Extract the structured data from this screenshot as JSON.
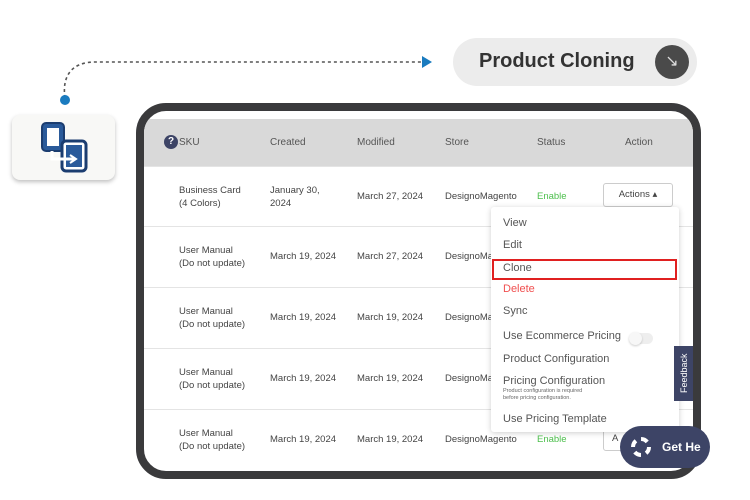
{
  "banner": {
    "title": "Product Cloning",
    "button_icon": "arrow-down-right-icon",
    "arrow_color": "#1a7bbf"
  },
  "table": {
    "headers": [
      "SKU",
      "Created",
      "Modified",
      "Store",
      "Status",
      "Action"
    ],
    "rows": [
      {
        "sku": [
          "Business Card",
          "(4 Colors)"
        ],
        "created": [
          "January 30,",
          "2024"
        ],
        "modified": "March 27, 2024",
        "store": "DesignoMagento",
        "status": "Enable",
        "action": "Actions"
      },
      {
        "sku": [
          "User Manual",
          "(Do not update)"
        ],
        "created": [
          "March 19, 2024",
          ""
        ],
        "modified": "March 27, 2024",
        "store": "DesignoMa",
        "status": "",
        "action": ""
      },
      {
        "sku": [
          "User Manual",
          "(Do not update)"
        ],
        "created": [
          "March 19, 2024",
          ""
        ],
        "modified": "March 19, 2024",
        "store": "DesignoMa",
        "status": "",
        "action": ""
      },
      {
        "sku": [
          "User Manual",
          "(Do not update)"
        ],
        "created": [
          "March 19, 2024",
          ""
        ],
        "modified": "March 19, 2024",
        "store": "DesignoMa",
        "status": "",
        "action": ""
      },
      {
        "sku": [
          "User Manual",
          "(Do not update)"
        ],
        "created": [
          "March 19, 2024",
          ""
        ],
        "modified": "March 19, 2024",
        "store": "DesignoMagento",
        "status": "Enable",
        "action": "A"
      }
    ]
  },
  "menu": {
    "items": [
      "View",
      "Edit",
      "Clone",
      "Delete",
      "Sync",
      "Use Ecommerce Pricing",
      "Product Configuration",
      "Pricing Configuration",
      "Use Pricing Template"
    ],
    "pricing_note": [
      "Product configuration is required",
      "before pricing configuration."
    ],
    "highlighted": "Clone",
    "ecommerce_toggle": false
  },
  "feedback": "Feedback",
  "get_help": "Get He",
  "colors": {
    "delete": "#f05050",
    "enable": "#4cbf4c",
    "highlight": "#e02020",
    "navy": "#3d4466"
  }
}
